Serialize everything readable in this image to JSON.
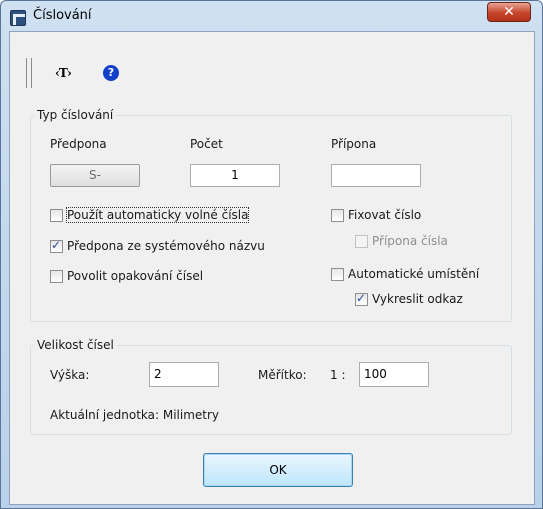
{
  "window": {
    "title": "Číslování",
    "close_glyph": "✕"
  },
  "toolbar": {
    "tag_icon_text": "‹T›",
    "help_icon_text": "?"
  },
  "typ_group": {
    "title": "Typ číslování",
    "predpona_label": "Předpona",
    "pocet_label": "Počet",
    "pripona_label": "Přípona",
    "predpona_value": "S-",
    "pocet_value": "1",
    "pripona_value": ""
  },
  "options": {
    "auto_free": {
      "label": "Použít automaticky volné čísla",
      "checked": false
    },
    "prefix_sys": {
      "label": "Předpona ze systémového názvu",
      "checked": true
    },
    "allow_repeat": {
      "label": "Povolit opakování čísel",
      "checked": false
    },
    "fix_number": {
      "label": "Fixovat číslo",
      "checked": false
    },
    "number_suffix": {
      "label": "Přípona čísla",
      "checked": false,
      "enabled": false
    },
    "auto_place": {
      "label": "Automatické umístění",
      "checked": false
    },
    "draw_ref": {
      "label": "Vykreslit odkaz",
      "checked": true
    }
  },
  "size_group": {
    "title": "Velikost čísel",
    "vyska_label": "Výška:",
    "vyska_value": "2",
    "meritko_label": "Měřítko:",
    "meritko_prefix": "1 :",
    "meritko_value": "100",
    "unit_text": "Aktuální jednotka: Milimetry"
  },
  "buttons": {
    "ok_label": "OK"
  }
}
